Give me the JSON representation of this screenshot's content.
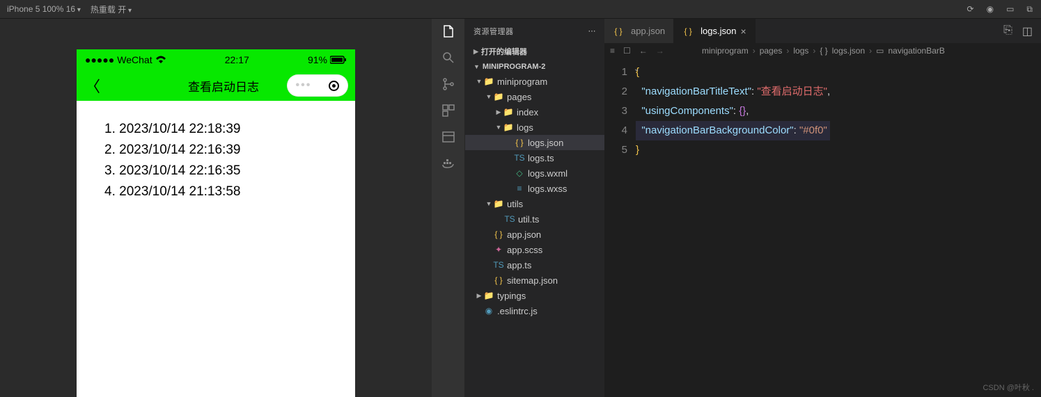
{
  "topbar": {
    "device_label": "iPhone 5 100% 16",
    "hot_reload_label": "热重载 开"
  },
  "phone": {
    "carrier": "WeChat",
    "time": "22:17",
    "battery_pct": "91%",
    "nav_title": "查看启动日志",
    "logs": [
      "1. 2023/10/14 22:18:39",
      "2. 2023/10/14 22:16:39",
      "3. 2023/10/14 22:16:35",
      "4. 2023/10/14 21:13:58"
    ]
  },
  "explorer": {
    "title": "资源管理器",
    "open_editors": "打开的编辑器",
    "project": "MINIPROGRAM-2",
    "tree": {
      "miniprogram": "miniprogram",
      "pages": "pages",
      "index": "index",
      "logs": "logs",
      "logs_json": "logs.json",
      "logs_ts": "logs.ts",
      "logs_wxml": "logs.wxml",
      "logs_wxss": "logs.wxss",
      "utils": "utils",
      "util_ts": "util.ts",
      "app_json": "app.json",
      "app_scss": "app.scss",
      "app_ts": "app.ts",
      "sitemap": "sitemap.json",
      "typings": "typings",
      "eslintrc": ".eslintrc.js"
    }
  },
  "tabs": {
    "app_json": "app.json",
    "logs_json": "logs.json"
  },
  "breadcrumb": {
    "p0": "miniprogram",
    "p1": "pages",
    "p2": "logs",
    "p3": "logs.json",
    "p4": "navigationBarB"
  },
  "code": {
    "lines": [
      "1",
      "2",
      "3",
      "4",
      "5"
    ],
    "l1": "{",
    "l2_key": "\"navigationBarTitleText\"",
    "l2_val": "\"查看启动日志\"",
    "l3_key": "\"usingComponents\"",
    "l4_key": "\"navigationBarBackgroundColor\"",
    "l4_val": "\"#0f0\"",
    "l5": "}"
  },
  "watermark": "CSDN @叶秋 ."
}
